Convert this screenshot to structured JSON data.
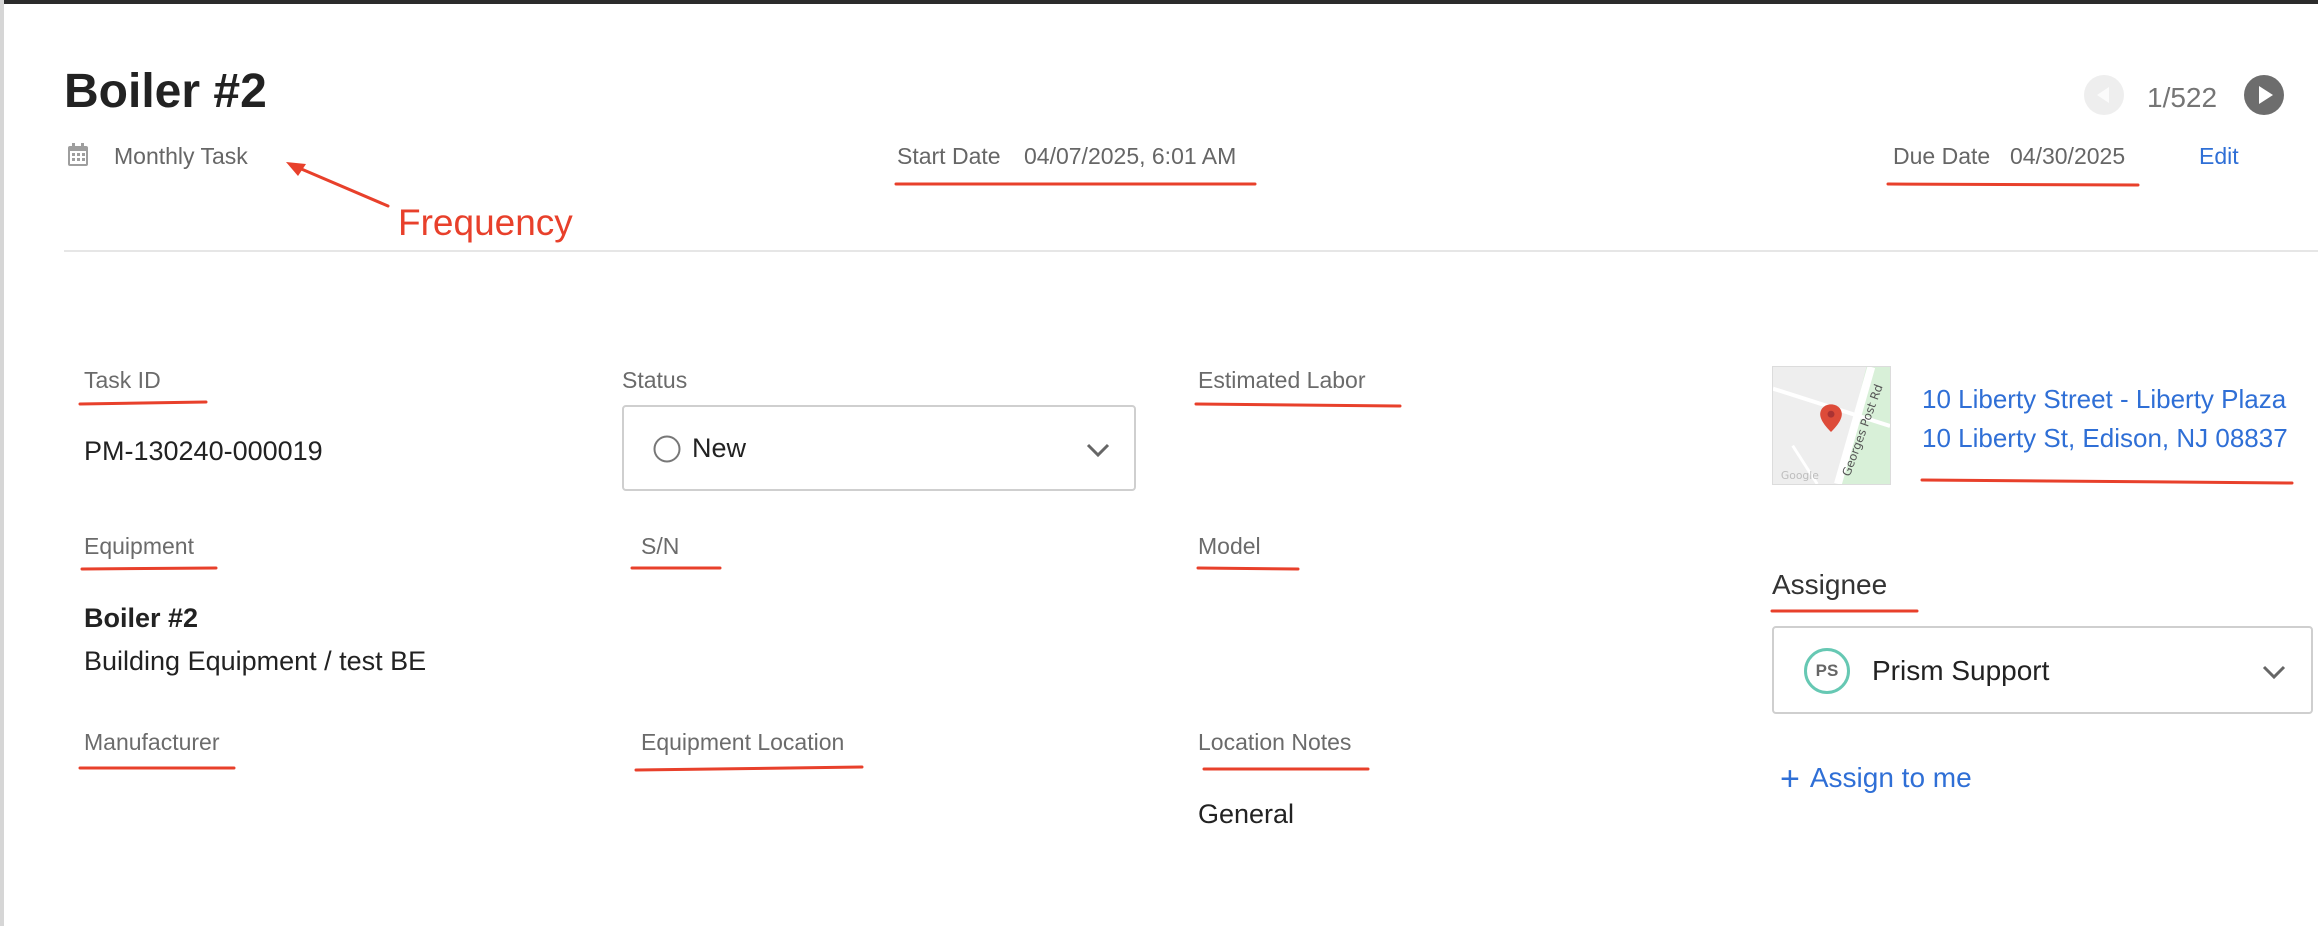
{
  "header": {
    "title": "Boiler #2",
    "frequency": "Monthly Task",
    "start_date_label": "Start Date",
    "start_date_value": "04/07/2025, 6:01 AM",
    "due_date_label": "Due Date",
    "due_date_value": "04/30/2025",
    "edit_label": "Edit",
    "pager": "1/522"
  },
  "annotation": {
    "frequency_label": "Frequency"
  },
  "fields": {
    "task_id_label": "Task ID",
    "task_id_value": "PM-130240-000019",
    "status_label": "Status",
    "status_value": "New",
    "estimated_labor_label": "Estimated Labor",
    "equipment_label": "Equipment",
    "equipment_name": "Boiler #2",
    "equipment_category": "Building Equipment / test BE",
    "sn_label": "S/N",
    "model_label": "Model",
    "manufacturer_label": "Manufacturer",
    "equipment_location_label": "Equipment Location",
    "location_notes_label": "Location Notes",
    "location_notes_value": "General"
  },
  "location": {
    "name": "10 Liberty Street - Liberty Plaza",
    "address": "10 Liberty St, Edison, NJ 08837",
    "map_street": "Georges Post Rd",
    "map_logo": "Google"
  },
  "assignee": {
    "label": "Assignee",
    "initials": "PS",
    "name": "Prism Support",
    "assign_me_label": "Assign to me"
  },
  "colors": {
    "accent": "#2f6fd6",
    "annotation": "#e8402b",
    "avatar_ring": "#66c8b3"
  }
}
